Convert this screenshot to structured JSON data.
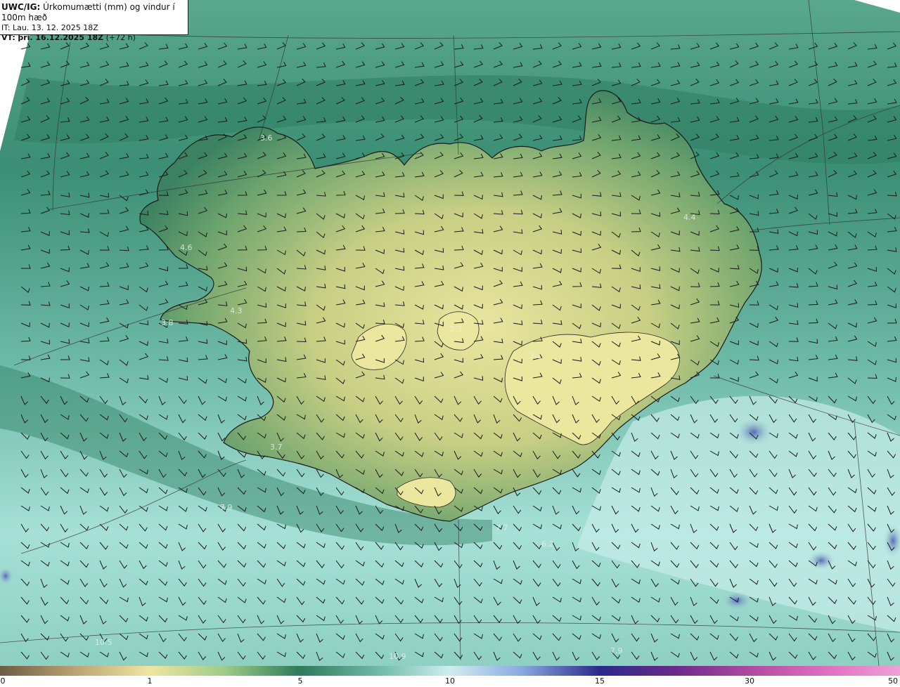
{
  "header": {
    "product_prefix": "UWC/IG:",
    "product_title": "Úrkomumætti (mm) og vindur í 100m hæð",
    "it_line": "IT: Lau. 13. 12. 2025 18Z",
    "vt_prefix": "VT:",
    "vt_value": "þri. 16.12.2025 18Z",
    "vt_suffix": "(+72 h)"
  },
  "map_values": [
    {
      "text": "3.6",
      "pos": "Westfjords north"
    },
    {
      "text": "4.4",
      "pos": "East coast"
    },
    {
      "text": "4.6",
      "pos": "Breidafjordur"
    },
    {
      "text": "4.3",
      "pos": "Snaefellsnes"
    },
    {
      "text": "3.8",
      "pos": "Snaefellsnes tip"
    },
    {
      "text": "3.7",
      "pos": "Reykjanes"
    },
    {
      "text": "7.9",
      "pos": "South-west sea"
    },
    {
      "text": "7.7",
      "pos": "South coast sea"
    },
    {
      "text": "6.2",
      "pos": "South sea"
    },
    {
      "text": "10.5",
      "pos": "South-west sea bottom"
    },
    {
      "text": "10.9",
      "pos": "South sea bottom"
    },
    {
      "text": "7.9",
      "pos": "South-east sea bottom"
    },
    {
      "text": "3.1",
      "pos": "Vatnajokull"
    },
    {
      "text": "2.3",
      "pos": "Hofsjokull"
    }
  ],
  "colorbar": {
    "ticks": [
      "0",
      "1",
      "5",
      "10",
      "15",
      "30",
      "50"
    ],
    "colors": [
      "#6b5a45",
      "#c4b27a",
      "#f0e6a0",
      "#2e7a5a",
      "#9fdcd0",
      "#cfeef0",
      "#2a2a8a",
      "#b04aa0",
      "#e070c0"
    ]
  },
  "colors": {
    "land_low": "#2f7a58",
    "land_high": "#e6e39a",
    "sea": "#7fc8b8",
    "sea_light": "#b5e6df",
    "precip_blue": "#6a78c0"
  }
}
